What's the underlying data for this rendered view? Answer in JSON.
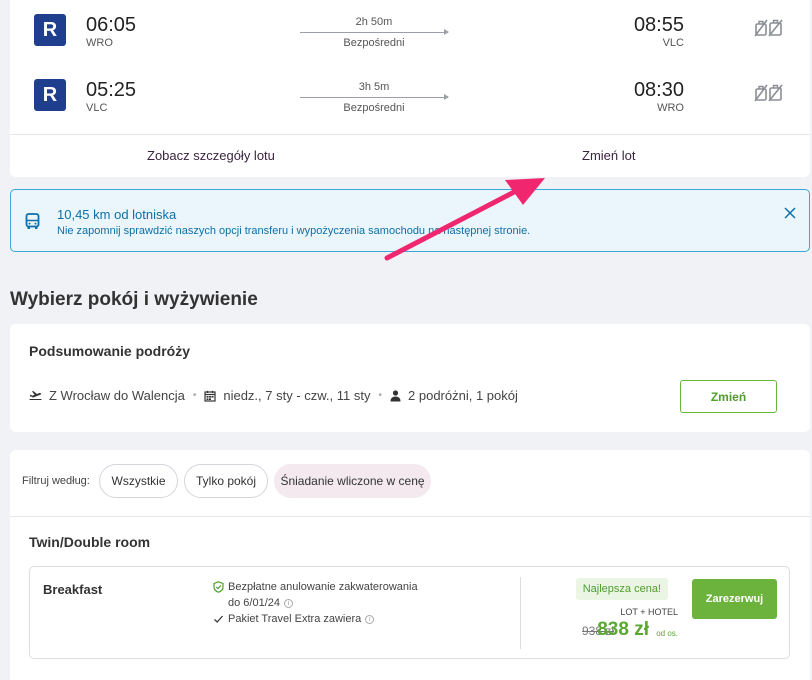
{
  "flights": [
    {
      "airline_logo": "R",
      "dep_time": "06:05",
      "dep_code": "WRO",
      "duration": "2h 50m",
      "type": "Bezpośredni",
      "arr_time": "08:55",
      "arr_code": "VLC",
      "icon": "no-baggage-icon"
    },
    {
      "airline_logo": "R",
      "dep_time": "05:25",
      "dep_code": "VLC",
      "duration": "3h 5m",
      "type": "Bezpośredni",
      "arr_time": "08:30",
      "arr_code": "WRO",
      "icon": "no-baggage-icon"
    }
  ],
  "flight_links": {
    "details": "Zobacz szczegóły lotu",
    "change": "Zmień lot"
  },
  "transfer": {
    "title": "10,45 km od lotniska",
    "text": "Nie zapomnij sprawdzić naszych opcji transferu i wypożyczenia samochodu na następnej stronie.",
    "icon": "bus-icon"
  },
  "section_title": "Wybierz pokój i wyżywienie",
  "summary": {
    "title": "Podsumowanie podróży",
    "route": "Z Wrocław do Walencja",
    "dates": "niedz., 7 sty - czw., 11 sty",
    "travelers": "2 podróżni, 1 pokój",
    "change_label": "Zmień"
  },
  "filters": {
    "label": "Filtruj według:",
    "options": [
      "Wszystkie",
      "Tylko pokój",
      "Śniadanie wliczone w cenę"
    ],
    "selected": "Śniadanie wliczone w cenę"
  },
  "room": {
    "title": "Twin/Double room",
    "offer": {
      "name": "Breakfast",
      "benefit_1_line_1": "Bezpłatne anulowanie zakwaterowania",
      "benefit_1_line_2": "do 6/01/24",
      "benefit_2": "Pakiet Travel Extra zawiera",
      "best_price": "Najlepsza cena!",
      "package": "LOT + HOTEL",
      "old_price": "938 zł",
      "new_price": "838 zł",
      "per_person": "od os.",
      "book_label": "Zarezerwuj"
    }
  },
  "colors": {
    "accent_green": "#6bb33d",
    "info_blue": "#0d6fa8",
    "airline_blue": "#1f3f8e",
    "arrow_pink": "#f0266f"
  }
}
